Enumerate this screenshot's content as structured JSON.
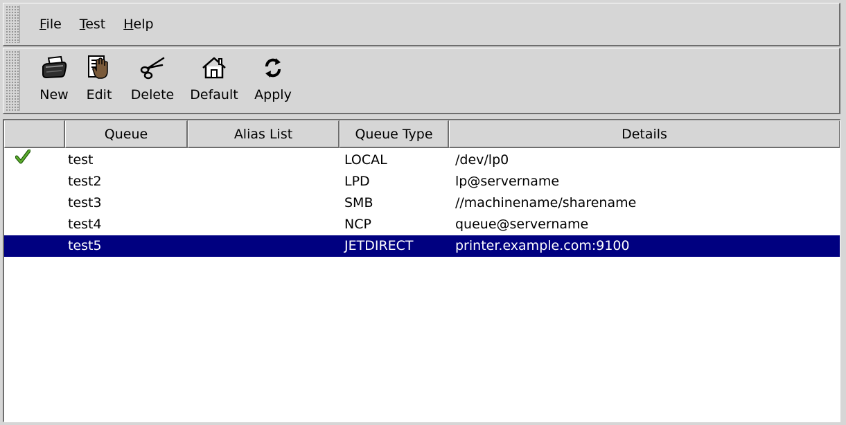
{
  "menubar": {
    "items": [
      {
        "mnemonic": "F",
        "rest": "ile"
      },
      {
        "mnemonic": "T",
        "rest": "est"
      },
      {
        "mnemonic": "H",
        "rest": "elp"
      }
    ]
  },
  "toolbar": {
    "buttons": [
      {
        "label": "New",
        "icon": "printer-icon"
      },
      {
        "label": "Edit",
        "icon": "edit-hand-icon"
      },
      {
        "label": "Delete",
        "icon": "scissors-icon"
      },
      {
        "label": "Default",
        "icon": "home-icon"
      },
      {
        "label": "Apply",
        "icon": "refresh-icon"
      }
    ]
  },
  "table": {
    "columns": [
      "",
      "Queue",
      "Alias List",
      "Queue Type",
      "Details"
    ],
    "rows": [
      {
        "default": true,
        "queue": "test",
        "alias": "",
        "type": "LOCAL",
        "details": "/dev/lp0",
        "selected": false
      },
      {
        "default": false,
        "queue": "test2",
        "alias": "",
        "type": "LPD",
        "details": "lp@servername",
        "selected": false
      },
      {
        "default": false,
        "queue": "test3",
        "alias": "",
        "type": "SMB",
        "details": "//machinename/sharename",
        "selected": false
      },
      {
        "default": false,
        "queue": "test4",
        "alias": "",
        "type": "NCP",
        "details": "queue@servername",
        "selected": false
      },
      {
        "default": false,
        "queue": "test5",
        "alias": "",
        "type": "JETDIRECT",
        "details": "printer.example.com:9100",
        "selected": true
      }
    ]
  },
  "colors": {
    "selection": "#000080",
    "checkmark": "#3a8a1a",
    "window_bg": "#d6d6d6"
  }
}
